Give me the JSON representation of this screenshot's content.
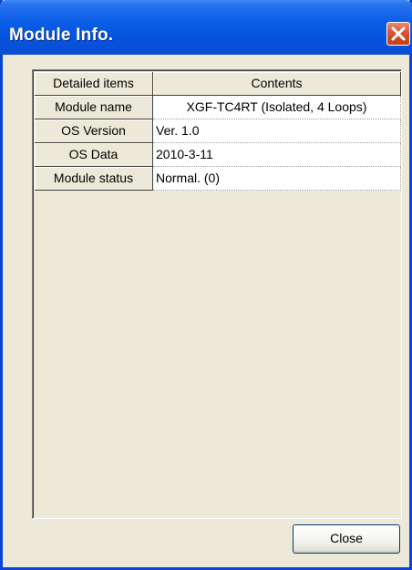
{
  "window": {
    "title": "Module Info.",
    "close_icon": "close-x-icon"
  },
  "table": {
    "headers": [
      "Detailed items",
      "Contents"
    ],
    "rows": [
      {
        "item": "Module name",
        "content": "XGF-TC4RT (Isolated, 4 Loops)"
      },
      {
        "item": "OS Version",
        "content": "Ver.  1.0"
      },
      {
        "item": "OS Data",
        "content": "2010-3-11"
      },
      {
        "item": "Module status",
        "content": "Normal. (0)"
      }
    ]
  },
  "buttons": {
    "close_label": "Close"
  },
  "colors": {
    "titlebar": "#0553dd",
    "window_bg": "#ece9d8",
    "close_x": "#d8542e"
  }
}
